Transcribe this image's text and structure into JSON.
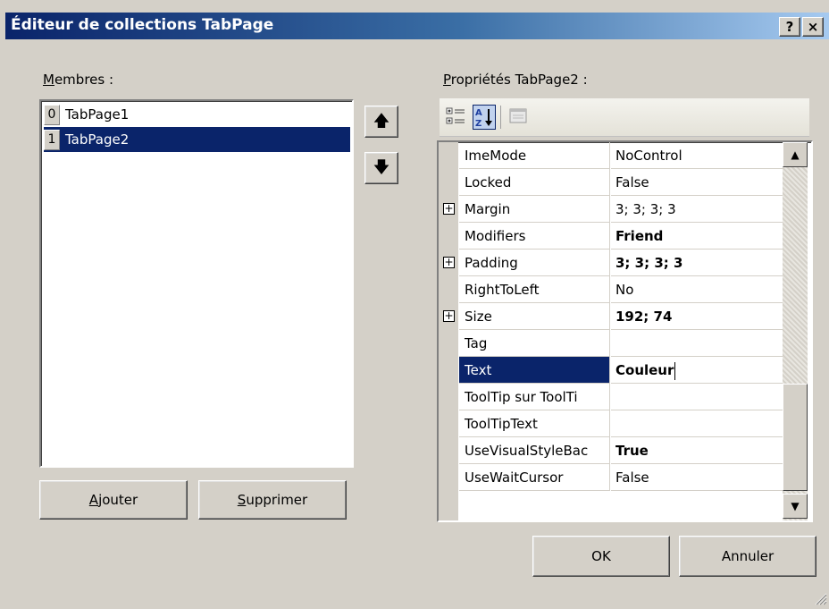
{
  "window": {
    "title": "Éditeur de collections TabPage",
    "help_label": "?",
    "close_label": "×"
  },
  "members": {
    "label_access": "M",
    "label_rest": "embres :",
    "items": [
      {
        "index": "0",
        "name": "TabPage1",
        "selected": false
      },
      {
        "index": "1",
        "name": "TabPage2",
        "selected": true
      }
    ],
    "up_icon": "arrow-up-icon",
    "down_icon": "arrow-down-icon",
    "up_label": "🡅",
    "down_label": "🡇"
  },
  "buttons": {
    "add_access": "A",
    "add_rest": "jouter",
    "remove_access": "S",
    "remove_rest": "upprimer",
    "ok": "OK",
    "cancel": "Annuler"
  },
  "properties": {
    "label_access": "P",
    "label_rest": "ropriétés TabPage2 :",
    "rows": [
      {
        "name": "ImeMode",
        "value": "NoControl",
        "bold": false,
        "expandable": false
      },
      {
        "name": "Locked",
        "value": "False",
        "bold": false,
        "expandable": false
      },
      {
        "name": "Margin",
        "value": "3; 3; 3; 3",
        "bold": false,
        "expandable": true
      },
      {
        "name": "Modifiers",
        "value": "Friend",
        "bold": true,
        "expandable": false
      },
      {
        "name": "Padding",
        "value": "3; 3; 3; 3",
        "bold": true,
        "expandable": true
      },
      {
        "name": "RightToLeft",
        "value": "No",
        "bold": false,
        "expandable": false
      },
      {
        "name": "Size",
        "value": "192; 74",
        "bold": true,
        "expandable": true
      },
      {
        "name": "Tag",
        "value": "",
        "bold": false,
        "expandable": false
      },
      {
        "name": "Text",
        "value": "Couleur",
        "bold": true,
        "expandable": false,
        "selected": true
      },
      {
        "name": "ToolTip sur ToolTi",
        "value": "",
        "bold": false,
        "expandable": false
      },
      {
        "name": "ToolTipText",
        "value": "",
        "bold": false,
        "expandable": false
      },
      {
        "name": "UseVisualStyleBac",
        "value": "True",
        "bold": true,
        "expandable": false
      },
      {
        "name": "UseWaitCursor",
        "value": "False",
        "bold": false,
        "expandable": false
      }
    ],
    "expander_label": "+",
    "scroll_up_label": "▲",
    "scroll_down_label": "▼"
  },
  "colors": {
    "selection": "#0a246a",
    "face": "#d4d0c8"
  }
}
